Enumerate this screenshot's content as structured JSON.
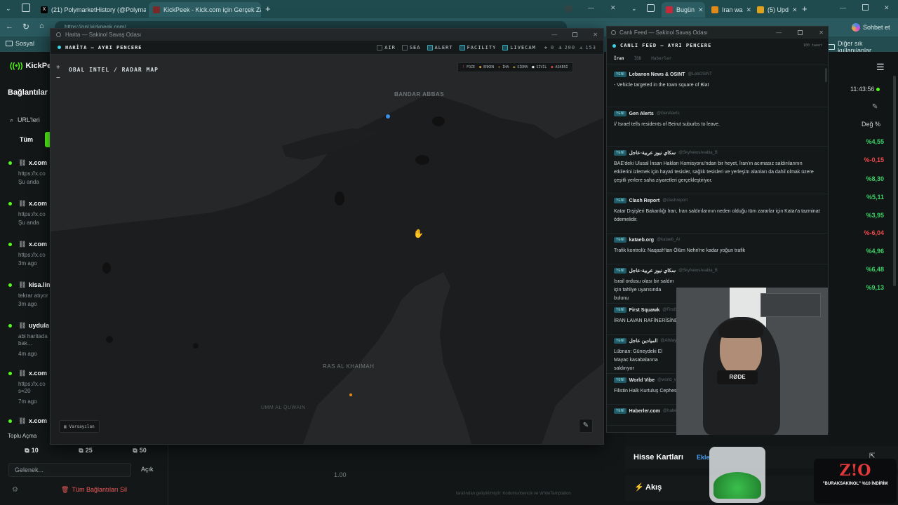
{
  "browser": {
    "tabs": [
      {
        "title": "(21) PolymarketHistory (@Polymar"
      },
      {
        "title": "KickPeek - Kick.com için Gerçek Za"
      },
      {
        "title": "Bugün"
      },
      {
        "title": "Iran wa"
      },
      {
        "title": "(5) Upd"
      }
    ],
    "bookmarks": [
      "Sosyal"
    ],
    "bookmarks_right": "Diğer sık kullanılanlar",
    "copilot": "Sohbet et",
    "url": "https://onl.kickpeek.com/..."
  },
  "leftpanel": {
    "brand": "KickPee",
    "section": "Bağlantılar",
    "search_placeholder": "URL'leri",
    "filter_all": "Tüm",
    "links": [
      {
        "name": "x.com",
        "url": "https://x.co",
        "time": "Şu anda"
      },
      {
        "name": "x.com",
        "url": "https://x.co",
        "time": "Şu anda"
      },
      {
        "name": "x.com",
        "url": "https://x.co",
        "time": "3m ago"
      },
      {
        "name": "kisa.lin",
        "url": "tekrar atıyor",
        "time": "3m ago"
      },
      {
        "name": "uydula",
        "url": "abi haritada bak...",
        "time": "4m ago"
      },
      {
        "name": "x.com",
        "url": "https://x.co s=20",
        "time": "7m ago"
      },
      {
        "name": "x.com",
        "url": "",
        "time": ""
      }
    ],
    "bulk_label": "Toplu Açma",
    "bulk_buttons": [
      "10",
      "25",
      "50"
    ],
    "incoming_placeholder": "Gelenek...",
    "open_label": "Açık",
    "delete_all": "Tüm Bağlantıları Sil"
  },
  "map": {
    "window_title": "Harita — Sakinol Savaş Odası",
    "header": "HARİTA — AYRI PENCERE",
    "filters": [
      {
        "label": "AIR",
        "on": false
      },
      {
        "label": "SEA",
        "on": false
      },
      {
        "label": "ALERT",
        "on": true
      },
      {
        "label": "FACILITY",
        "on": true
      },
      {
        "label": "LIVECAM",
        "on": true
      }
    ],
    "counter_a": "0",
    "counter_b": "200",
    "counter_c": "153",
    "subtitle": "OBAL INTEL / RADAR MAP",
    "legend": [
      "FOZE",
      "ERKEN",
      "İHA",
      "SİDMA",
      "SİVİL",
      "ASKERİ"
    ],
    "zoom_in": "+",
    "zoom_out": "−",
    "places": [
      "BANDAR ABBAS",
      "RAS AL KHAIMAH",
      "UMM AL QUWAIN"
    ],
    "default_button": "Varsayılan",
    "footer": "tarafından geliştirilmiştir: Kodumunbencik ve WhiteTemptation",
    "zoom_value": "1.00"
  },
  "feed": {
    "window_title": "Canlı Feed — Sakinol Savaş Odası",
    "header": "CANLI FEED — AYRI PENCERE",
    "count": "100 tweet",
    "tabs": [
      "İran",
      "İBB",
      "Haberler"
    ],
    "badge": "YENİ",
    "items": [
      {
        "source": "Lebanon News & OSINT",
        "handle": "@LebOSINT",
        "text": "- Vehicle targeted in the town square of Biat"
      },
      {
        "source": "Gen Alerts",
        "handle": "@GenAlerts",
        "text": "// Israel tells residents of Beirut suburbs to leave."
      },
      {
        "source": "سكاي نيوز عربية-عاجل",
        "handle": "@SkyNewsArabia_B",
        "text": "BAE'deki Ulusal İnsan Hakları Komisyonu'ndan bir heyet, İran'ın acımasız saldırılarının etkilerini izlemek için hayati tesisler, sağlık tesisleri ve yerleşim alanları da dahil olmak üzere çeşitli yerlere saha ziyaretleri gerçekleştiriyor."
      },
      {
        "source": "Clash Report",
        "handle": "@clashreport",
        "text": "Katar Dışişleri Bakanlığı İran, İran saldırılarının neden olduğu tüm zararlar için Katar'a tazminat ödemelidir."
      },
      {
        "source": "kataeb.org",
        "handle": "@kataeb_Ar",
        "text": "Trafik kontrolü: Naqash'tan Ölüm Nehri'ne kadar yoğun trafik"
      },
      {
        "source": "سكاي نيوز عربية-عاجل",
        "handle": "@SkyNewsArabia_B",
        "text": "İsrail ordusu olası bir saldırı için tahliye uyarısında bulunu"
      },
      {
        "source": "First Squawk",
        "handle": "@FirstSq",
        "text": "İRAN LAVAN RAFİNERİSİNDE"
      },
      {
        "source": "الميادين عاجل",
        "handle": "@AlMaya",
        "text": "Lübnan: Güneydeki El Mayac kasabalarına saldırıyor"
      },
      {
        "source": "World Vibe",
        "handle": "@world_v",
        "text": "Filistin Halk Kurtuluş Cephes"
      },
      {
        "source": "Haberler.com",
        "handle": "@haber",
        "text": ""
      }
    ]
  },
  "stocks": {
    "time": "11:43:56",
    "column": "Değ %",
    "values": [
      "%4,55",
      "%-0,15",
      "%8,30",
      "%5,11",
      "%3,95",
      "%-6,04",
      "%4,96",
      "%6,48",
      "%9,13"
    ],
    "cards_label": "Hisse Kartları",
    "add_label": "Ekle",
    "flow_label": "Akış"
  },
  "overlay": {
    "logo": "Z!O",
    "promo": "\"BURAKSAKINOL\" %10 İNDİRİM",
    "mic_label": "RØDE"
  }
}
